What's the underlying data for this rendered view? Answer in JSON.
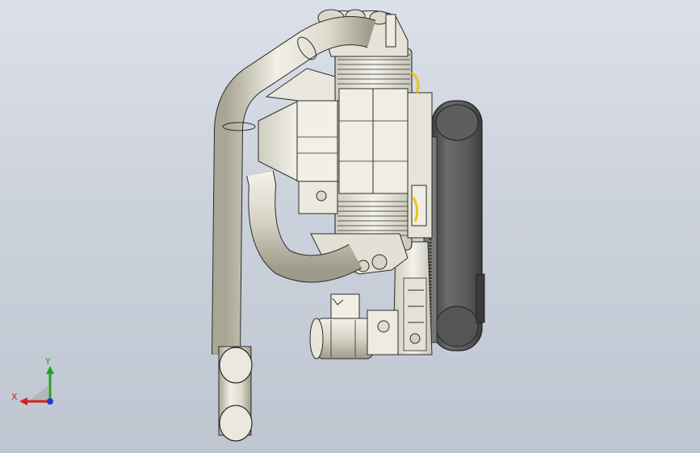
{
  "viewport": {
    "background_top": "#dbe0e9",
    "background_bottom": "#bfc6d1"
  },
  "model": {
    "body_color": "#e9e7dc",
    "outline_color": "#2b2b2b",
    "belt_color": "#5c5c5c",
    "accent_color": "#e8c51a"
  },
  "triad": {
    "x_label": "X",
    "y_label": "Y",
    "x_color": "#d42020",
    "y_color": "#1fa61f",
    "z_color": "#1f3cd4"
  }
}
